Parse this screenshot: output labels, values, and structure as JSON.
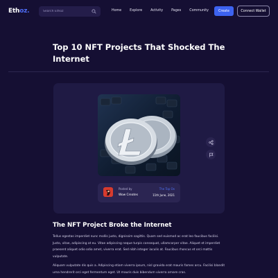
{
  "header": {
    "logo_main": "Eth",
    "logo_accent": "oz.",
    "search_placeholder": "Search Ethoz",
    "nav": [
      "Home",
      "Explore",
      "Activity",
      "Pages",
      "Community"
    ],
    "create_label": "Create",
    "wallet_label": "Connect Wallet"
  },
  "article": {
    "title": "Top 10 NFT Projects That Shocked The Internet",
    "posted_label": "Posted by",
    "author": "Wow Creates",
    "tag": "The Top Ox",
    "date": "11th June, 2021",
    "section_heading": "The NFT Project Broke the Internet",
    "paragraph1": "Tellus egestas imperdiet nunc mollis justo, dignissim sagittis. Quam sed euismod ac erat leo faucibus facilisi. Justo, vitae, adipiscing at eu. Vitae adipiscing neque turpis consequat, ullamcorper vitae. Aliquet et imperdiet praesent aliquet odio odio amet, viverra erat. Sed nibh integer iaculis at. Faucibus rhoncus et orci mattis vulputate.",
    "paragraph2": "Aliquam vulputate dis quis a. Adipiscing etiam viverra ipsum, nisl gravida erat mauris fames arcu. Facilisi blandit urna hendrerit orci eget fermentum eget. Ut mauris duis bibendum viverra ornare cras."
  },
  "colors": {
    "background": "#150f33",
    "card": "#1f1a44",
    "accent": "#3d63f0",
    "link": "#4f73f7"
  },
  "icons": [
    "search-icon",
    "share-icon",
    "flag-icon",
    "coin-image",
    "avatar-icon"
  ]
}
